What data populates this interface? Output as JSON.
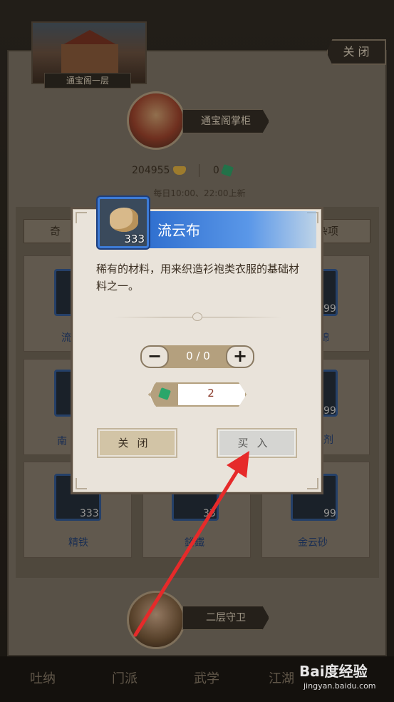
{
  "shop": {
    "building_label": "通宝阁一层",
    "close_label": "关 闭",
    "keeper_name": "通宝阁掌柜",
    "gold_amount": "204955",
    "jade_amount": "0",
    "schedule": "每日10:00、22:00上新",
    "tab_left": "奇",
    "tab_right": "杂项",
    "guard_name": "二层守卫",
    "background_items": [
      {
        "count": "",
        "name": "流"
      },
      {
        "count": "99",
        "name": "錦"
      },
      {
        "count": "",
        "name": "南"
      },
      {
        "count": "99",
        "name": "剂"
      },
      {
        "count": "333",
        "name": "精铁"
      },
      {
        "count": "33",
        "name": "鋊鐵"
      },
      {
        "count": "99",
        "name": "金云砂"
      }
    ]
  },
  "bottom_nav": [
    {
      "label": "吐纳"
    },
    {
      "label": "门派"
    },
    {
      "label": "武学"
    },
    {
      "label": "江湖"
    }
  ],
  "dialog": {
    "item_name": "流云布",
    "item_count": "333",
    "description": "稀有的材料，用来织造衫袍类衣服的基础材料之一。",
    "quantity": "0 / 0",
    "minus_label": "−",
    "plus_label": "+",
    "price": "2",
    "close_label": "关闭",
    "buy_label": "买入"
  },
  "watermark": {
    "brand": "Bai度经验",
    "url": "jingyan.baidu.com"
  },
  "colors": {
    "title_blue": "#2f6fcf",
    "arrow_red": "#e62a2a",
    "price_red": "#8a3a2a",
    "jade_green": "#2aa66a"
  }
}
